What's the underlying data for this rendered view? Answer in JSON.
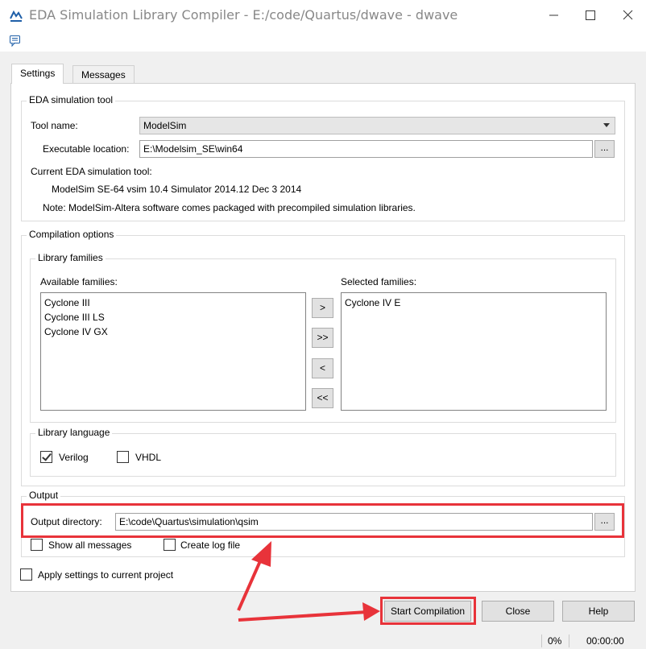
{
  "window": {
    "title": "EDA Simulation Library Compiler - E:/code/Quartus/dwave - dwave",
    "buttons": [
      "minimize-icon",
      "maximize-icon",
      "close-icon"
    ]
  },
  "tabs": [
    {
      "label": "Settings",
      "active": true
    },
    {
      "label": "Messages",
      "active": false
    }
  ],
  "eda_tool": {
    "group_title": "EDA simulation tool",
    "tool_name_label": "Tool name:",
    "tool_name_value": "ModelSim",
    "exec_label": "Executable location:",
    "exec_value": "E:\\Modelsim_SE\\win64",
    "browse_label": "...",
    "current_label": "Current EDA simulation tool:",
    "current_value": "ModelSim SE-64 vsim 10.4 Simulator 2014.12 Dec  3 2014",
    "note": "Note: ModelSim-Altera software comes packaged with precompiled simulation libraries."
  },
  "compilation": {
    "group_title": "Compilation options",
    "families_title": "Library families",
    "available_label": "Available families:",
    "available": [
      "Cyclone III",
      "Cyclone III LS",
      "Cyclone IV GX"
    ],
    "selected_label": "Selected families:",
    "selected": [
      "Cyclone IV E"
    ],
    "move_buttons": [
      ">",
      ">>",
      "<",
      "<<"
    ],
    "language_title": "Library language",
    "verilog_label": "Verilog",
    "verilog_checked": true,
    "vhdl_label": "VHDL",
    "vhdl_checked": false
  },
  "output": {
    "group_title": "Output",
    "dir_label": "Output directory:",
    "dir_value": "E:\\code\\Quartus\\simulation\\qsim",
    "browse_label": "...",
    "show_all_label": "Show all messages",
    "show_all_checked": false,
    "log_label": "Create log file",
    "log_checked": false
  },
  "apply_label": "Apply settings to current project",
  "apply_checked": false,
  "buttons": {
    "start": "Start Compilation",
    "close": "Close",
    "help": "Help"
  },
  "status": {
    "progress": "0%",
    "time": "00:00:00"
  },
  "colors": {
    "highlight": "#e8333a"
  }
}
